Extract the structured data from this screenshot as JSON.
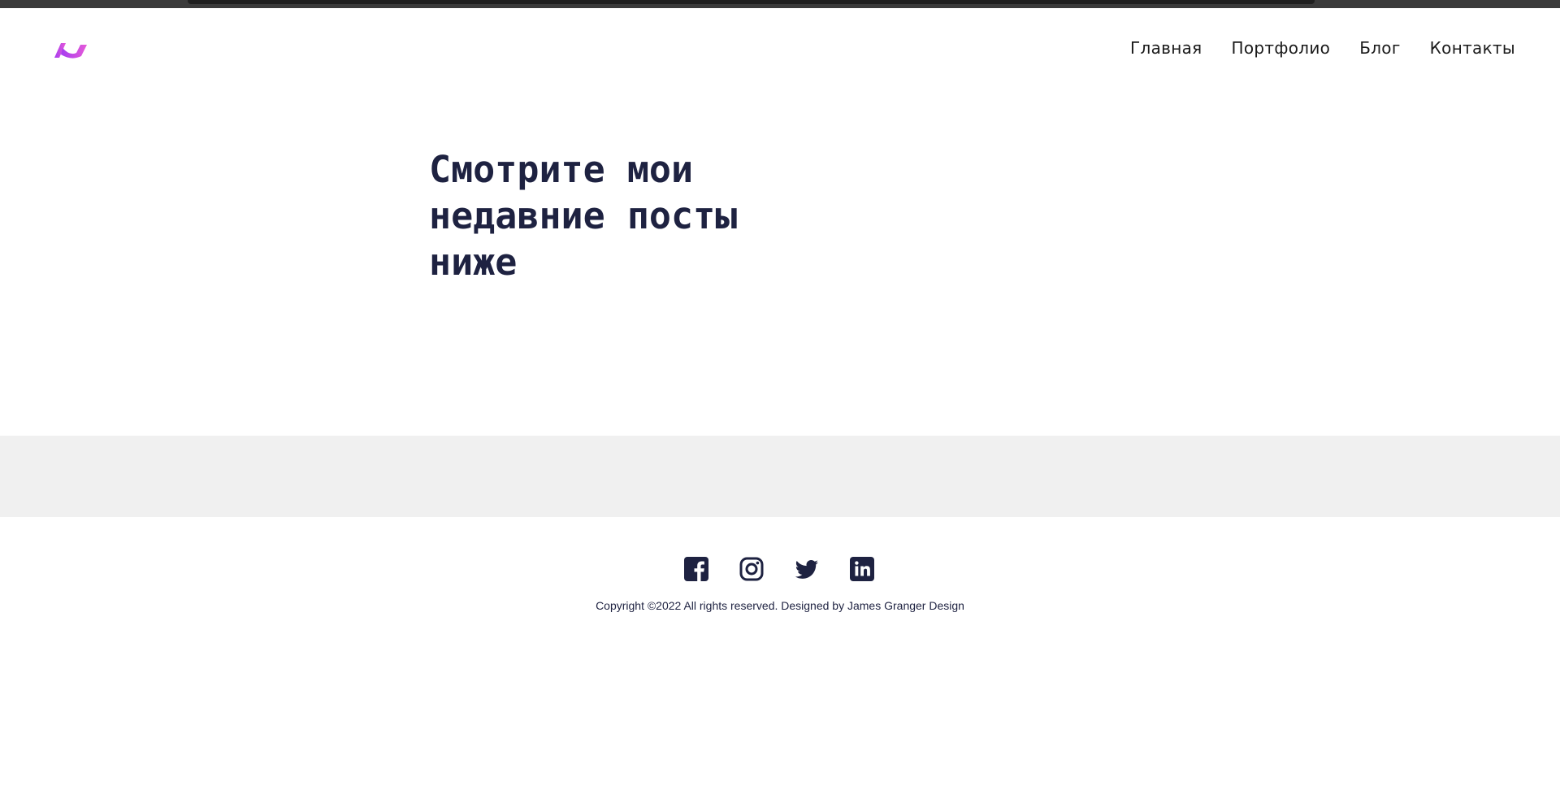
{
  "nav": {
    "items": [
      {
        "label": "Главная"
      },
      {
        "label": "Портфолио"
      },
      {
        "label": "Блог"
      },
      {
        "label": "Контакты"
      }
    ]
  },
  "hero": {
    "title": "Смотрите мои недавние посты ниже"
  },
  "footer": {
    "social": [
      {
        "icon": "facebook-icon"
      },
      {
        "icon": "instagram-icon"
      },
      {
        "icon": "twitter-icon"
      },
      {
        "icon": "linkedin-icon"
      }
    ],
    "copyright": "Copyright ©2022 All rights reserved. Designed by James Granger Design"
  },
  "colors": {
    "text_dark": "#1e2241",
    "band_grey": "#f0f0f0",
    "logo_purple": "#a63df0",
    "logo_pink": "#e65ad8"
  }
}
